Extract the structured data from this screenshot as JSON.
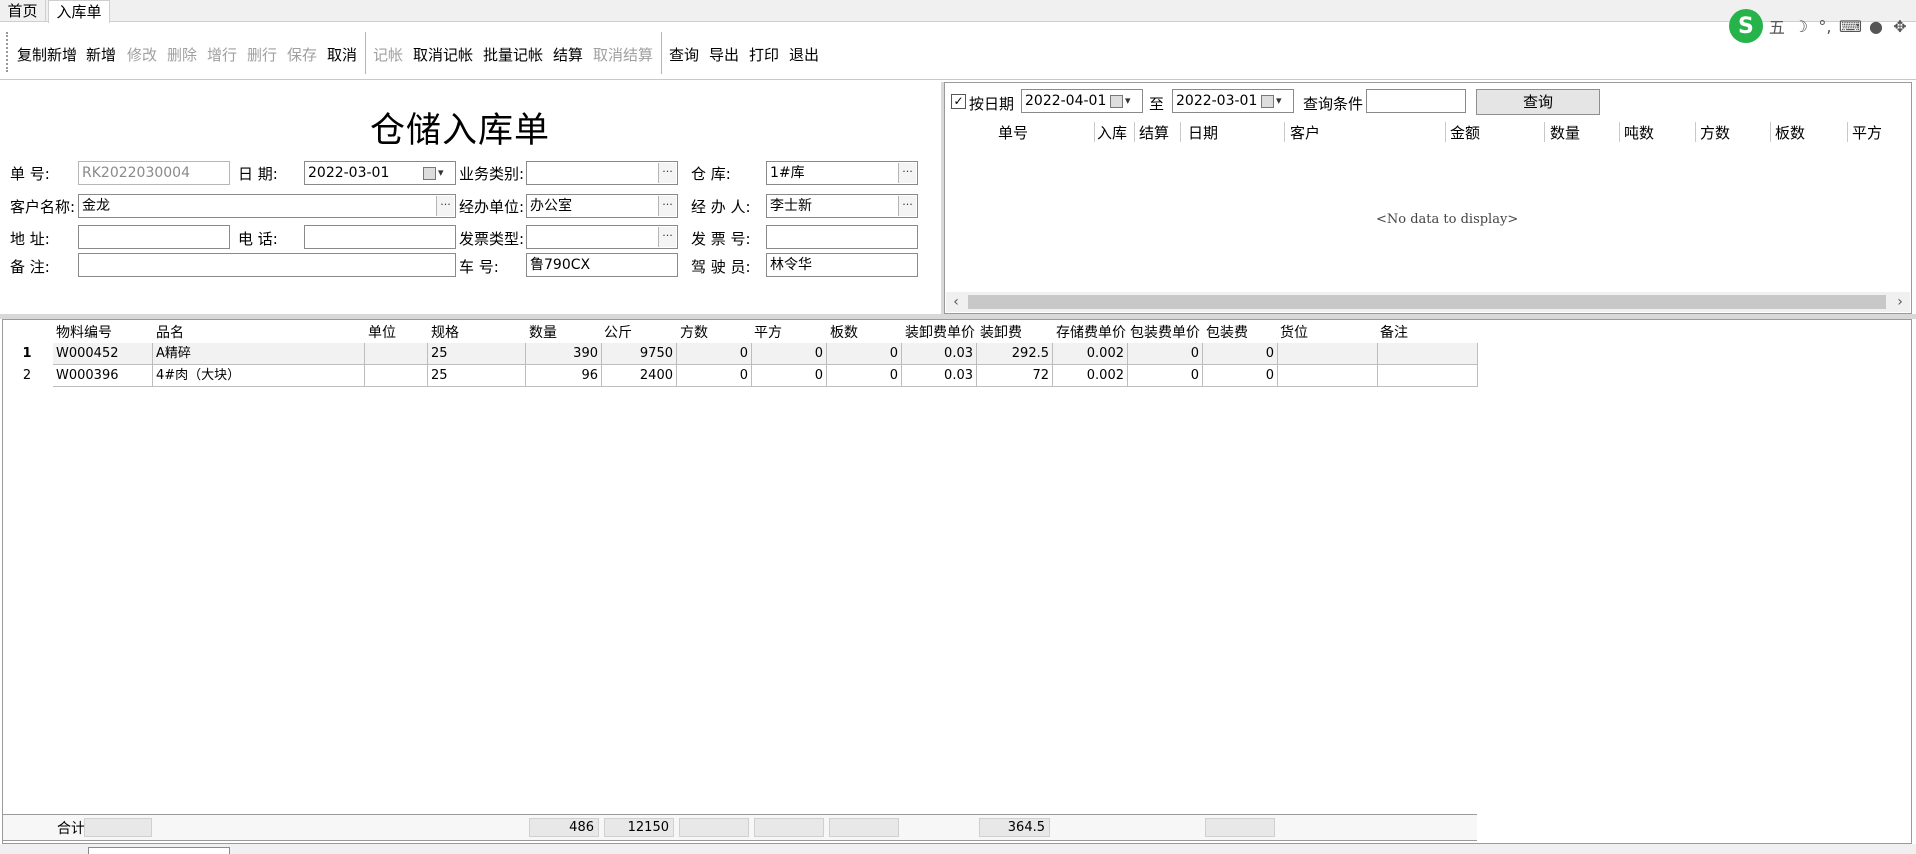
{
  "tabs": [
    {
      "label": "首页"
    },
    {
      "label": "入库单"
    }
  ],
  "ime": {
    "logo": "S",
    "mode": "五",
    "icons": [
      "moon-icon",
      "punctuation-icon",
      "keyboard-icon",
      "user-icon",
      "grid-icon"
    ],
    "punct": "°,"
  },
  "toolbar": {
    "items": [
      {
        "label": "复制新增",
        "enabled": true
      },
      {
        "label": "新增",
        "enabled": true
      },
      {
        "label": "修改",
        "enabled": false
      },
      {
        "label": "删除",
        "enabled": false
      },
      {
        "label": "增行",
        "enabled": false
      },
      {
        "label": "删行",
        "enabled": false
      },
      {
        "label": "保存",
        "enabled": false
      },
      {
        "label": "取消",
        "enabled": true
      },
      {
        "label": "记帐",
        "enabled": false
      },
      {
        "label": "取消记帐",
        "enabled": true
      },
      {
        "label": "批量记帐",
        "enabled": true
      },
      {
        "label": "结算",
        "enabled": true
      },
      {
        "label": "取消结算",
        "enabled": false
      },
      {
        "label": "查询",
        "enabled": true
      },
      {
        "label": "导出",
        "enabled": true
      },
      {
        "label": "打印",
        "enabled": true
      },
      {
        "label": "退出",
        "enabled": true
      }
    ]
  },
  "form": {
    "title": "仓储入库单",
    "fields": {
      "order_no": {
        "label": "单    号:",
        "value": "RK2022030004"
      },
      "date": {
        "label": "日    期:",
        "value": "2022-03-01"
      },
      "business_type": {
        "label": "业务类别:",
        "value": ""
      },
      "warehouse": {
        "label": "仓    库:",
        "value": "1#库"
      },
      "customer": {
        "label": "客户名称:",
        "value": "金龙"
      },
      "dept": {
        "label": "经办单位:",
        "value": "办公室"
      },
      "handler": {
        "label": "经 办 人:",
        "value": "李士新"
      },
      "address": {
        "label": "地    址:",
        "value": ""
      },
      "phone": {
        "label": "电    话:",
        "value": ""
      },
      "invoice_type": {
        "label": "发票类型:",
        "value": ""
      },
      "invoice_no": {
        "label": "发 票 号:",
        "value": ""
      },
      "remark": {
        "label": "备    注:",
        "value": ""
      },
      "vehicle": {
        "label": "车    号:",
        "value": "鲁790CX"
      },
      "driver": {
        "label": "驾 驶 员:",
        "value": "林令华"
      }
    }
  },
  "query": {
    "by_date_label": "按日期",
    "by_date_checked": true,
    "from": "2022-04-01",
    "to_label": "至",
    "to": "2022-03-01",
    "cond_label": "查询条件",
    "cond_value": "",
    "button": "查询",
    "columns": [
      "单号",
      "入库",
      "结算",
      "日期",
      "客户",
      "金额",
      "数量",
      "吨数",
      "方数",
      "板数",
      "平方"
    ],
    "empty_text": "<No data to display>"
  },
  "grid": {
    "columns": [
      "物料编号",
      "品名",
      "单位",
      "规格",
      "数量",
      "公斤",
      "方数",
      "平方",
      "板数",
      "装卸费单价",
      "装卸费",
      "存储费单价",
      "包装费单价",
      "包装费",
      "货位",
      "备注"
    ],
    "rows": [
      {
        "n": "1",
        "cells": [
          "W000452",
          "A精碎",
          "",
          "25",
          "390",
          "9750",
          "0",
          "0",
          "0",
          "0.03",
          "292.5",
          "0.002",
          "0",
          "0",
          "",
          ""
        ]
      },
      {
        "n": "2",
        "cells": [
          "W000396",
          "4#肉（大块）",
          "",
          "25",
          "96",
          "2400",
          "0",
          "0",
          "0",
          "0.03",
          "72",
          "0.002",
          "0",
          "0",
          "",
          ""
        ]
      }
    ],
    "total_label": "合计",
    "totals": {
      "qty": "486",
      "kg": "12150",
      "handling": "364.5"
    }
  }
}
